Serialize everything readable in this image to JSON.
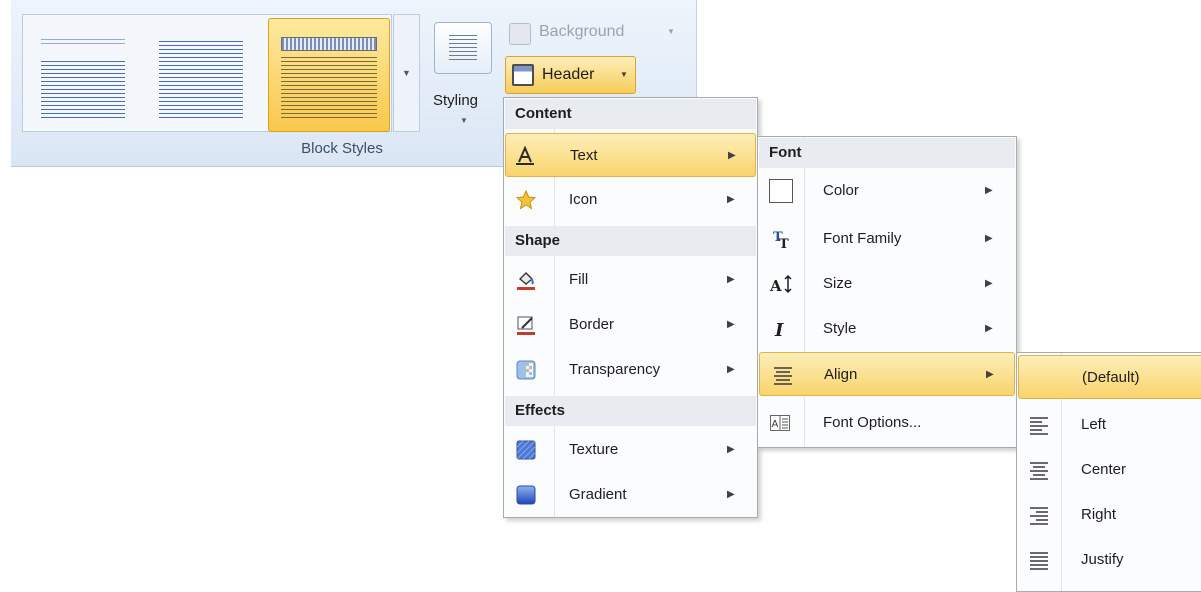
{
  "ribbon": {
    "group_label": "Block Styles",
    "styling_label": "Styling",
    "background_label": "Background",
    "header_label": "Header"
  },
  "menu1": {
    "sections": {
      "content": "Content",
      "shape": "Shape",
      "effects": "Effects"
    },
    "items": {
      "text": "Text",
      "icon": "Icon",
      "fill": "Fill",
      "border": "Border",
      "transparency": "Transparency",
      "texture": "Texture",
      "gradient": "Gradient"
    }
  },
  "menu2": {
    "section": "Font",
    "items": {
      "color": "Color",
      "font_family": "Font Family",
      "size": "Size",
      "style": "Style",
      "align": "Align",
      "font_options": "Font Options..."
    }
  },
  "menu3": {
    "items": {
      "default": "(Default)",
      "left": "Left",
      "center": "Center",
      "right": "Right",
      "justify": "Justify"
    }
  },
  "colors": {
    "highlight_top": "#fdeeb8",
    "highlight_bottom": "#f9d46c",
    "ribbon_bg": "#e2ecf8",
    "menu_bg": "#fbfcfd"
  }
}
